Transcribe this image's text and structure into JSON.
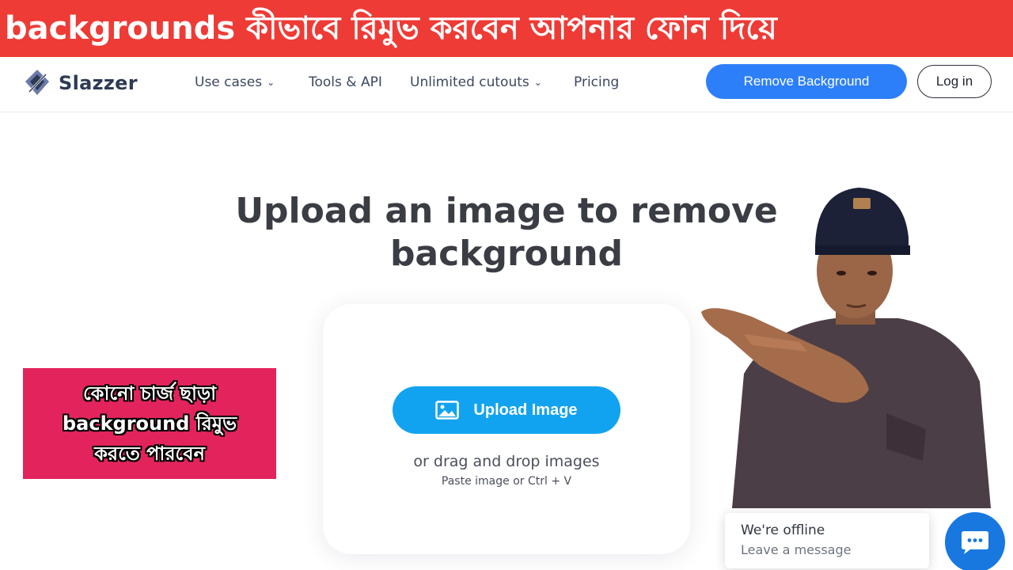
{
  "banner": {
    "text": "backgrounds কীভাবে রিমুভ করবেন আপনার ফোন দিয়ে"
  },
  "header": {
    "brand": "Slazzer",
    "nav": [
      {
        "label": "Use cases",
        "has_dropdown": true
      },
      {
        "label": "Tools & API",
        "has_dropdown": false
      },
      {
        "label": "Unlimited cutouts",
        "has_dropdown": true
      },
      {
        "label": "Pricing",
        "has_dropdown": false
      }
    ],
    "remove_background_label": "Remove Background",
    "login_label": "Log in"
  },
  "main": {
    "headline": "Upload an image to remove background",
    "upload_label": "Upload Image",
    "drag_text": "or drag and drop images",
    "paste_text": "Paste image or Ctrl + V"
  },
  "promo": {
    "line1": "কোনো চার্জ ছাড়া",
    "line2": "background রিমুভ",
    "line3": "করতে পারবেন"
  },
  "chat": {
    "title": "We're offline",
    "subtitle": "Leave a message"
  },
  "colors": {
    "banner": "#ee3b36",
    "primary_button": "#2d7ff9",
    "upload_button": "#12a3f0",
    "promo": "#e3245c",
    "chat_button": "#1878e0"
  },
  "icons": [
    "slazzer-logo-icon",
    "chevron-down-icon",
    "image-icon",
    "chat-icon"
  ]
}
